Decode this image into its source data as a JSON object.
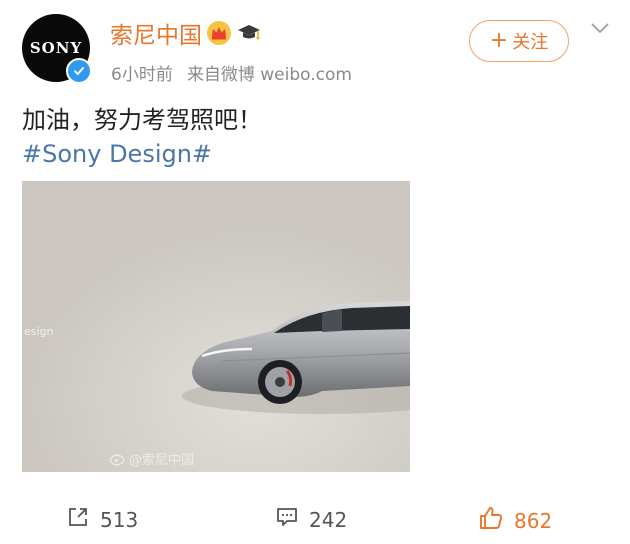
{
  "post": {
    "avatar_logo": "SONY",
    "user_name": "索尼中国",
    "time": "6小时前",
    "source": "来自微博 weibo.com",
    "follow_label": "关注",
    "text": "加油，努力考驾照吧！",
    "hashtag": "#Sony Design#",
    "image": {
      "side_watermark": "esign",
      "watermark": "@索尼中国"
    }
  },
  "actions": {
    "reposts": "513",
    "comments": "242",
    "likes": "862"
  },
  "colors": {
    "name": "#e8762d",
    "link": "#4a76a8",
    "verified": "#2f9af0",
    "like": "#e8762d"
  }
}
